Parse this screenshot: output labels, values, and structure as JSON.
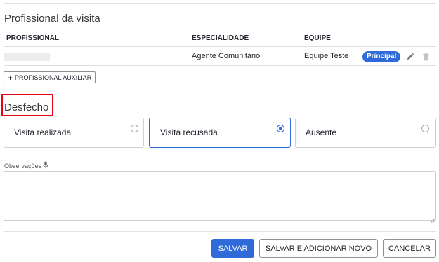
{
  "section": {
    "title": "Profissional da visita"
  },
  "table": {
    "headers": [
      "PROFISSIONAL",
      "ESPECIALIDADE",
      "EQUIPE"
    ],
    "row": {
      "especialidade": "Agente Comunitário",
      "equipe": "Equipe Teste",
      "badge": "Principal"
    }
  },
  "aux_button": {
    "label": "PROFISSIONAL AUXILIAR"
  },
  "desfecho": {
    "title": "Desfecho",
    "options": [
      {
        "label": "Visita realizada",
        "selected": false
      },
      {
        "label": "Visita recusada",
        "selected": true
      },
      {
        "label": "Ausente",
        "selected": false
      }
    ]
  },
  "observacoes": {
    "label": "Observações",
    "value": ""
  },
  "actions": {
    "save": "SALVAR",
    "save_add": "SALVAR E ADICIONAR NOVO",
    "cancel": "CANCELAR"
  },
  "colors": {
    "primary": "#2f6ad9",
    "highlight_box": "#e30613"
  },
  "icons": [
    "pencil-icon",
    "trash-icon",
    "microphone-icon",
    "plus-icon",
    "resize-grip-icon"
  ]
}
